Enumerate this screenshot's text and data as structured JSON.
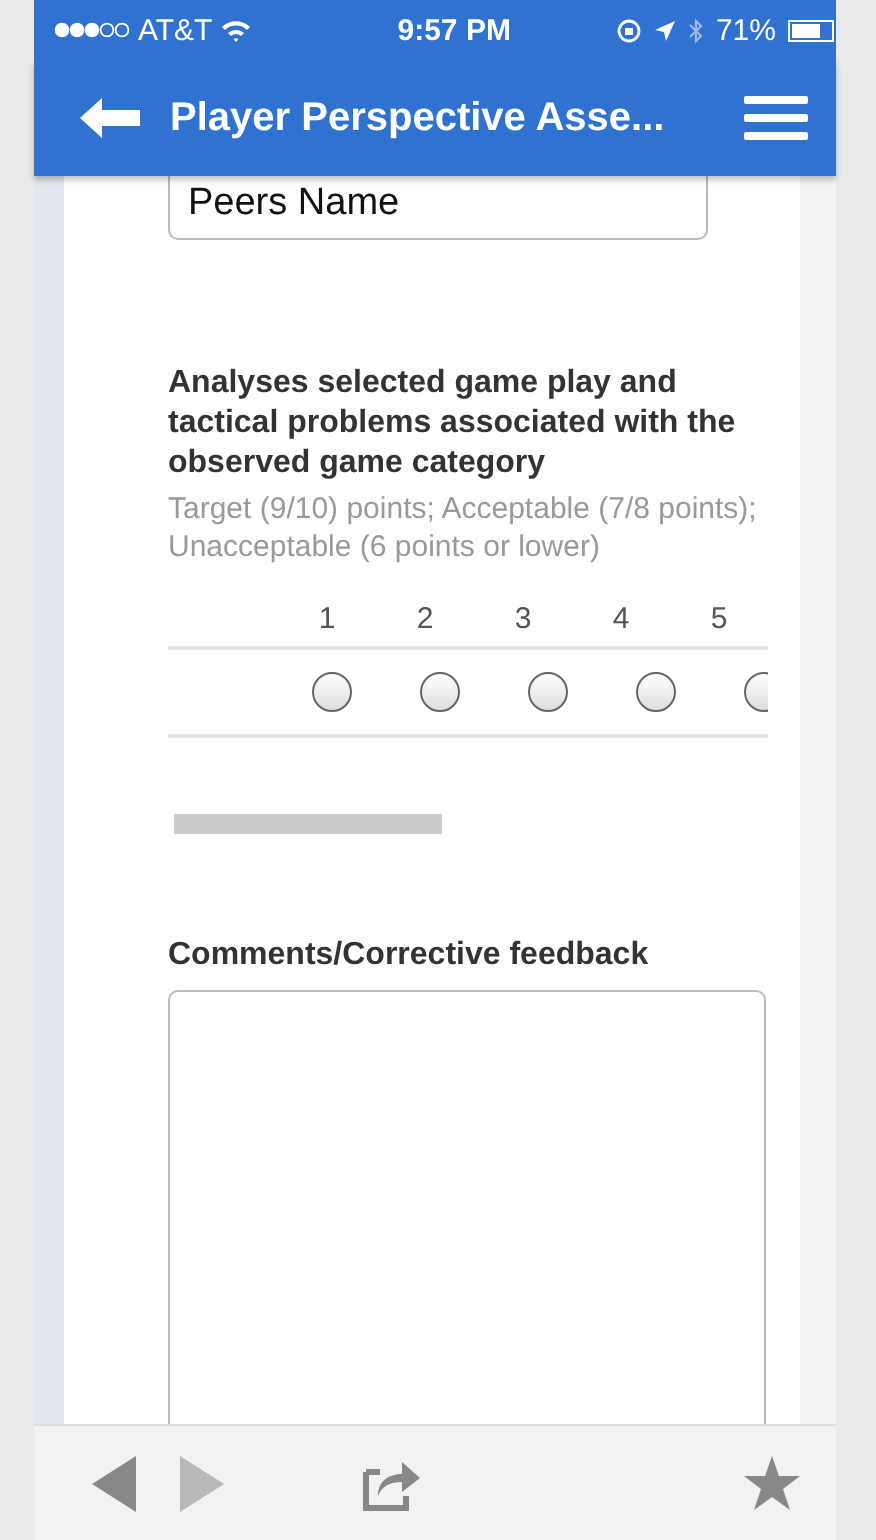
{
  "status_bar": {
    "carrier": "AT&T",
    "time": "9:57 PM",
    "battery": "71%"
  },
  "nav_bar": {
    "title": "Player Perspective Asse..."
  },
  "peer_field": {
    "value": "Peers Name"
  },
  "question": {
    "title": "Analyses selected game play and tactical problems associated with the observed game category",
    "help": "Target (9/10) points; Acceptable (7/8 points); Unacceptable (6 points or lower)",
    "options": [
      {
        "label": "1",
        "selected": false
      },
      {
        "label": "2",
        "selected": false
      },
      {
        "label": "3",
        "selected": false
      },
      {
        "label": "4",
        "selected": false
      },
      {
        "label": "5",
        "selected": false
      }
    ]
  },
  "comments": {
    "label": "Comments/Corrective feedback"
  }
}
